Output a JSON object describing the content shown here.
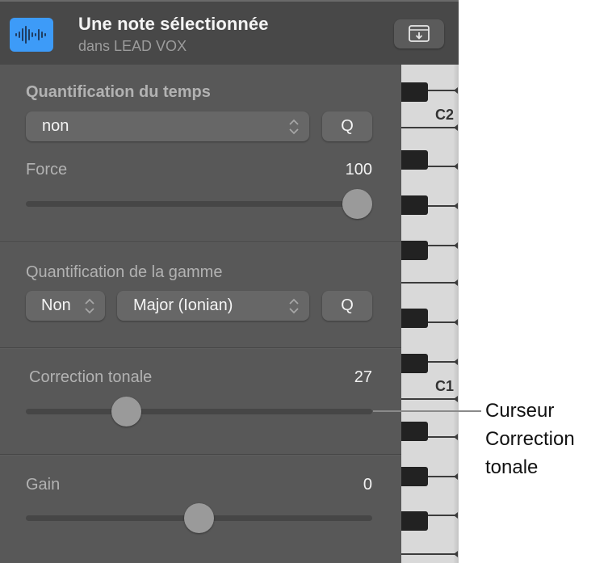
{
  "header": {
    "track_icon": "waveform-icon",
    "title": "Une note sélectionnée",
    "subtitle": "dans LEAD VOX",
    "action_button_icon": "window-download-icon",
    "accent_color": "#3d9bf8"
  },
  "time_quantize": {
    "label": "Quantification du temps",
    "popup_value": "non",
    "q_button": "Q",
    "strength": {
      "label": "Force",
      "value": "100",
      "fraction": 1.0
    }
  },
  "scale_quantize": {
    "label": "Quantification de la gamme",
    "mode_value": "Non",
    "scale_value": "Major (Ionian)",
    "q_button": "Q"
  },
  "pitch_correction": {
    "label": "Correction tonale",
    "value": "27",
    "fraction": 0.27
  },
  "gain": {
    "label": "Gain",
    "value": "0",
    "fraction": 0.5
  },
  "piano": {
    "labels": [
      "C2",
      "C1"
    ]
  },
  "callout": {
    "lines": [
      "Curseur",
      "Correction",
      "tonale"
    ]
  }
}
